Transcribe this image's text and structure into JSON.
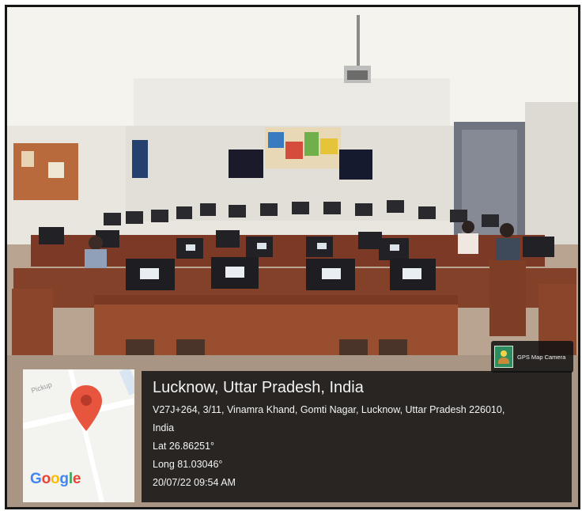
{
  "overlay": {
    "badge_label": "GPS Map Camera",
    "badge_icon": "landscape-icon",
    "title": "Lucknow, Uttar Pradesh, India",
    "address_line1": "V27J+264, 3/11, Vinamra Khand, Gomti Nagar, Lucknow, Uttar Pradesh 226010,",
    "address_line2": "India",
    "latitude": "Lat 26.86251°",
    "longitude": "Long 81.03046°",
    "datetime": "20/07/22 09:54 AM"
  },
  "map": {
    "street_label": "Pickup",
    "logo_letters": [
      "G",
      "o",
      "o",
      "g",
      "l",
      "e"
    ],
    "logo_colors": [
      "#4285F4",
      "#EA4335",
      "#FBBC05",
      "#4285F4",
      "#34A853",
      "#EA4335"
    ],
    "pin_color": "#E8553E",
    "pin_icon": "map-pin-icon"
  }
}
